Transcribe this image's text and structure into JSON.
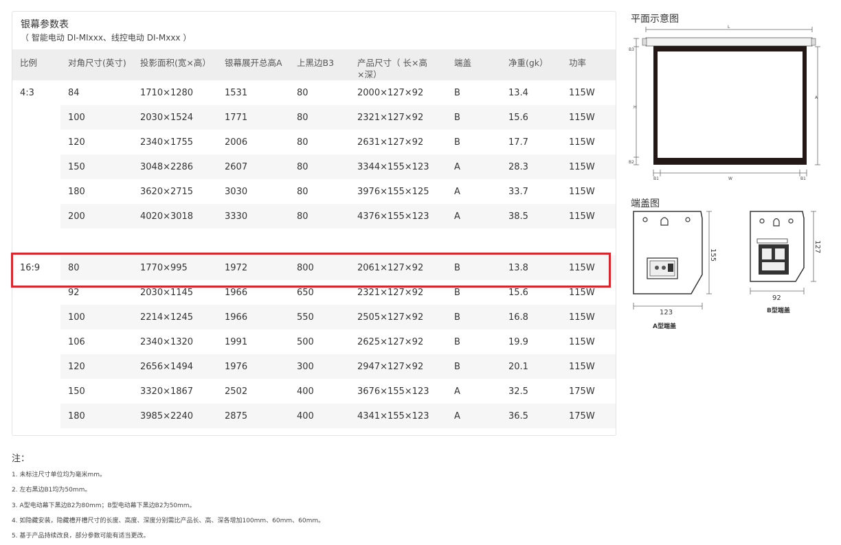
{
  "table": {
    "title": "银幕参数表",
    "subtitle": "（ 智能电动 DI-MIxxx、线控电动 DI-Mxxx ）",
    "headers": [
      "比例",
      "对角尺寸(英寸)",
      "投影面积(宽×高）",
      "银幕展开总高A",
      "上黑边B3",
      "产品尺寸（ 长×高×深）",
      "端盖",
      "净重(gk）",
      "功率"
    ],
    "group1": {
      "ratio": "4:3",
      "rows": [
        [
          "84",
          "1710×1280",
          "1531",
          "80",
          "2000×127×92",
          "B",
          "13.4",
          "115W"
        ],
        [
          "100",
          "2030×1524",
          "1771",
          "80",
          "2321×127×92",
          "B",
          "15.6",
          "115W"
        ],
        [
          "120",
          "2340×1755",
          "2006",
          "80",
          "2631×127×92",
          "B",
          "17.7",
          "115W"
        ],
        [
          "150",
          "3048×2286",
          "2607",
          "80",
          "3344×155×123",
          "A",
          "28.3",
          "115W"
        ],
        [
          "180",
          "3620×2715",
          "3030",
          "80",
          "3976×155×125",
          "A",
          "33.7",
          "115W"
        ],
        [
          "200",
          "4020×3018",
          "3330",
          "80",
          "4376×155×123",
          "A",
          "38.5",
          "115W"
        ]
      ]
    },
    "group2": {
      "ratio": "16:9",
      "rows": [
        [
          "80",
          "1770×995",
          "1972",
          "800",
          "2061×127×92",
          "B",
          "13.8",
          "115W"
        ],
        [
          "92",
          "2030×1145",
          "1966",
          "650",
          "2321×127×92",
          "B",
          "15.6",
          "115W"
        ],
        [
          "100",
          "2214×1245",
          "1966",
          "550",
          "2505×127×92",
          "B",
          "16.8",
          "115W"
        ],
        [
          "106",
          "2340×1320",
          "1991",
          "500",
          "2625×127×92",
          "B",
          "19.9",
          "115W"
        ],
        [
          "120",
          "2656×1494",
          "1976",
          "300",
          "2947×127×92",
          "B",
          "20.1",
          "115W"
        ],
        [
          "150",
          "3320×1867",
          "2502",
          "400",
          "3676×155×123",
          "A",
          "32.5",
          "175W"
        ],
        [
          "180",
          "3985×2240",
          "2875",
          "400",
          "4341×155×123",
          "A",
          "36.5",
          "175W"
        ]
      ]
    },
    "highlight_color": "#d9252b"
  },
  "plan": {
    "title": "平面示意图",
    "labels": {
      "L": "L",
      "B3": "B3",
      "H": "H",
      "A": "A",
      "B2": "B2",
      "B1": "B1",
      "W": "W"
    }
  },
  "endcap": {
    "title": "端盖图",
    "a": {
      "width": "123",
      "height": "155",
      "caption": "A型端盖"
    },
    "b": {
      "width": "92",
      "height": "127",
      "caption": "B型端盖"
    }
  },
  "notes": {
    "title": "注：",
    "items": [
      "1. 未标注尺寸单位均为毫米mm。",
      "2. 左右黑边B1均为50mm。",
      "3. A型电动幕下黑边B2为80mm；B型电动幕下黑边B2为50mm。",
      "4. 如隐藏安装，隐藏槽开槽尺寸的长度、高度、深度分别需比产品长、高、深各增加100mm、60mm、60mm。",
      "5. 基于产品持续改良，部分参数可能有适当更改。"
    ]
  }
}
